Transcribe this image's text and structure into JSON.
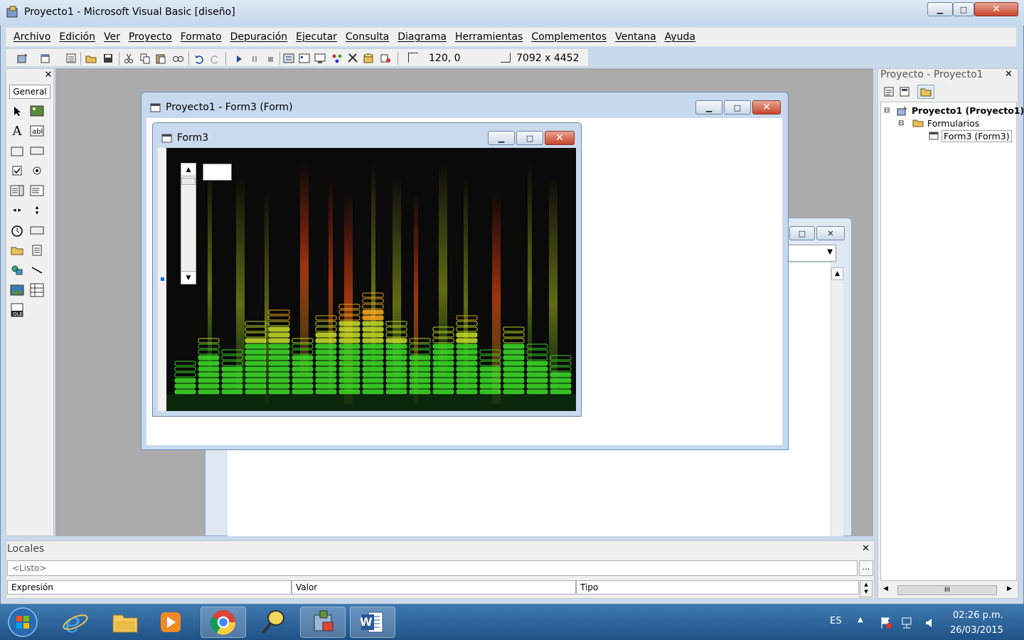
{
  "window": {
    "title": "Proyecto1 - Microsoft Visual Basic [diseño]"
  },
  "menu": [
    "Archivo",
    "Edición",
    "Ver",
    "Proyecto",
    "Formato",
    "Depuración",
    "Ejecutar",
    "Consulta",
    "Diagrama",
    "Herramientas",
    "Complementos",
    "Ventana",
    "Ayuda"
  ],
  "toolbar": {
    "position": "120, 0",
    "size": "7092 x 4452"
  },
  "toolbox": {
    "tab_label": "General",
    "close": "✕"
  },
  "designer": {
    "title": "Proyecto1 - Form3 (Form)"
  },
  "form3": {
    "title": "Form3"
  },
  "project": {
    "panel_title": "Proyecto - Proyecto1",
    "close": "✕",
    "root": "Proyecto1 (Proyecto1)",
    "folder": "Formularios",
    "form": "Form3 (Form3)"
  },
  "locals": {
    "title": "Locales",
    "close": "✕",
    "context": "<Listo>",
    "ellipsis": "...",
    "columns": [
      "Expresión",
      "Valor",
      "Tipo"
    ]
  },
  "scroll_glyphs": {
    "up": "▲",
    "down": "▼",
    "left": "◀",
    "right": "▶",
    "grip": "III"
  },
  "caption_glyphs": {
    "minimize": "▁",
    "maximize": "□",
    "close": "✕"
  },
  "taskbar": {
    "language": "ES",
    "time": "02:26 p.m.",
    "date": "26/03/2015",
    "word_label": "W"
  },
  "colors": {
    "titlebar": "#c4d7ec",
    "workspace": "#ababab",
    "taskbar": "#1f5286",
    "close_button": "#c8462c"
  }
}
